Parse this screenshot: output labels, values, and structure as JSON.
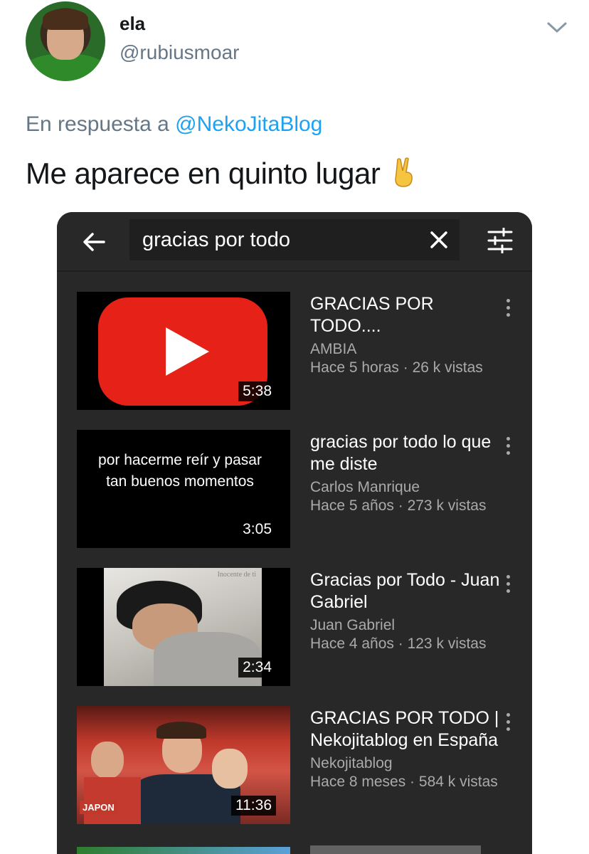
{
  "tweet": {
    "display_name": "ela",
    "handle": "@rubiusmoar",
    "reply_prefix": "En respuesta a",
    "reply_mention": "@NekoJitaBlog",
    "text": "Me aparece en quinto lugar",
    "emoji": "victory-hand"
  },
  "app": {
    "search_query": "gracias por todo",
    "icons": [
      "back-arrow-icon",
      "clear-icon",
      "filter-icon",
      "more-vertical-icon"
    ]
  },
  "results": [
    {
      "title": "GRACIAS POR TODO....",
      "channel": "AMBIA",
      "meta": "Hace 5 horas · 26 k vistas",
      "duration": "5:38",
      "thumbnail": "youtube-logo"
    },
    {
      "title": "gracias por todo lo que me diste",
      "channel": "Carlos Manrique",
      "meta": "Hace 5 años · 273 k vistas",
      "duration": "3:05",
      "thumbnail_text": "por hacerme reír y pasar tan buenos momentos"
    },
    {
      "title": "Gracias por Todo - Juan Gabriel",
      "channel": "Juan Gabriel",
      "meta": "Hace 4 años · 123 k vistas",
      "duration": "2:34",
      "thumbnail_caption": "Inocente de ti"
    },
    {
      "title": "GRACIAS POR TODO | Nekojitablog en España",
      "channel": "Nekojitablog",
      "meta": "Hace 8 meses · 584 k vistas",
      "duration": "11:36",
      "thumbnail_badge": "JAPON"
    }
  ],
  "colors": {
    "link_blue": "#1da1f2",
    "muted_gray": "#657786",
    "app_background": "#282828",
    "youtube_red": "#e62117"
  }
}
